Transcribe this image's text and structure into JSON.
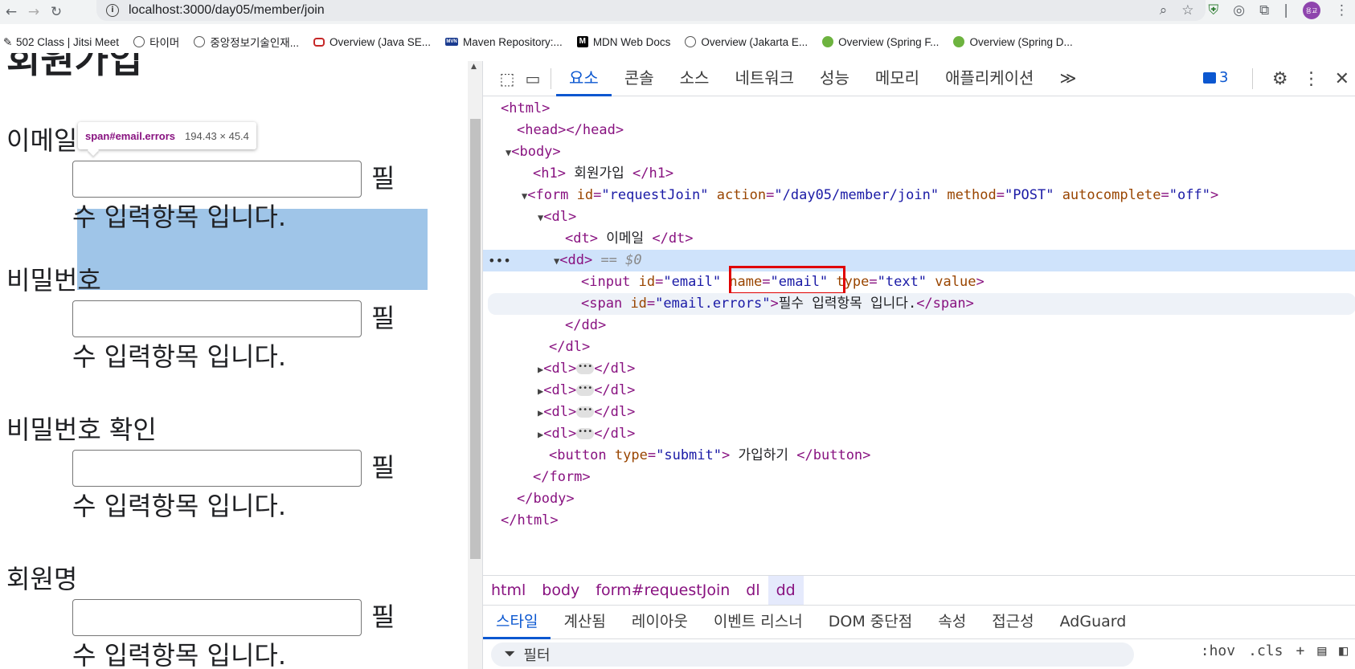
{
  "browser": {
    "url": "localhost:3000/day05/member/join",
    "avatar_label": "용교"
  },
  "bookmarks": [
    {
      "label": "502 Class | Jitsi Meet",
      "icon": "jitsi-icon"
    },
    {
      "label": "타이머",
      "icon": "globe-icon"
    },
    {
      "label": "중앙정보기술인재...",
      "icon": "globe-icon"
    },
    {
      "label": "Overview (Java SE...",
      "icon": "oracle-icon"
    },
    {
      "label": "Maven Repository:...",
      "icon": "maven-icon"
    },
    {
      "label": "MDN Web Docs",
      "icon": "mdn-icon"
    },
    {
      "label": "Overview (Jakarta E...",
      "icon": "globe-icon"
    },
    {
      "label": "Overview (Spring F...",
      "icon": "spring-icon"
    },
    {
      "label": "Overview (Spring D...",
      "icon": "spring-icon"
    }
  ],
  "page": {
    "heading": "회원가입",
    "fields": [
      {
        "label": "이메일",
        "error": "필",
        "error_cont": "수 입력항목 입니다."
      },
      {
        "label": "비밀번호",
        "error": "필",
        "error_cont": "수 입력항목 입니다."
      },
      {
        "label": "비밀번호 확인",
        "error": "필",
        "error_cont": "수 입력항목 입니다."
      },
      {
        "label": "회원명",
        "error": "필",
        "error_cont": "수 입력항목 입니다."
      }
    ],
    "tooltip": {
      "selector": "span#email.errors",
      "size": "194.43 × 45.4"
    }
  },
  "devtools": {
    "tabs": [
      "요소",
      "콘솔",
      "소스",
      "네트워크",
      "성능",
      "메모리",
      "애플리케이션"
    ],
    "more": "≫",
    "messages_count": "3",
    "breadcrumbs": [
      "html",
      "body",
      "form#requestJoin",
      "dl",
      "dd"
    ],
    "subtabs": [
      "스타일",
      "계산됨",
      "레이아웃",
      "이벤트 리스너",
      "DOM 중단점",
      "속성",
      "접근성",
      "AdGuard"
    ],
    "filter_placeholder": "필터",
    "filter_tools": [
      ":hov",
      ".cls",
      "+"
    ],
    "tree": {
      "html_open": "<html>",
      "head": "<head></head>",
      "body_open": "<body>",
      "h1_open": "<h1>",
      "h1_text": " 회원가입 ",
      "h1_close": "</h1>",
      "form_tag": "<form",
      "form_attrs": [
        {
          "name": "id",
          "value": "\"requestJoin\""
        },
        {
          "name": "action",
          "value": "\"/day05/member/join\""
        },
        {
          "name": "method",
          "value": "\"POST\""
        },
        {
          "name": "autocomplete",
          "value": "\"off\""
        }
      ],
      "dl_open": "<dl>",
      "dt_open": "<dt>",
      "dt_text": " 이메일 ",
      "dt_close": "</dt>",
      "dd_open": "<dd>",
      "dd_marker": "== $0",
      "input_tag": "<input",
      "input_id_name": "id",
      "input_id_val": "\"email\"",
      "input_name_name": "name",
      "input_name_val": "\"email\"",
      "input_type_name": "type",
      "input_type_val": "\"text\"",
      "input_value_name": "value",
      "input_end": ">",
      "span_tag": "<span",
      "span_id_name": "id",
      "span_id_val": "\"email.errors\"",
      "span_text": "필수 입력항목 입니다.",
      "span_close": "</span>",
      "dd_close": "</dd>",
      "dl_close": "</dl>",
      "collapsed_dl_open": "<dl>",
      "collapsed_dl_close": "</dl>",
      "button_tag": "<button",
      "button_type_name": "type",
      "button_type_val": "\"submit\"",
      "button_text": " 가입하기 ",
      "button_close": "</button>",
      "form_close": "</form>",
      "body_close": "</body>",
      "html_close": "</html>"
    }
  }
}
